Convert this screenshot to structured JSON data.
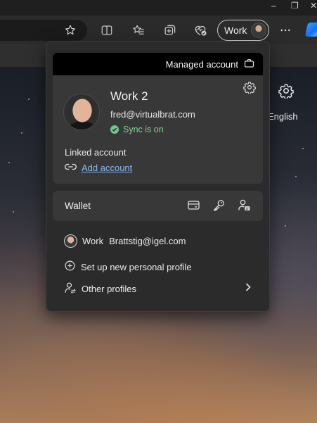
{
  "browser": {
    "profile_button_label": "Work",
    "window_controls": [
      "–",
      "❐",
      "✕"
    ]
  },
  "toolbar_icons": [
    "star-icon",
    "split-screen-icon",
    "favorites-icon",
    "collections-icon",
    "performance-icon",
    "more-icon",
    "copilot-icon"
  ],
  "ntp": {
    "language_label": "English"
  },
  "flyout": {
    "managed_label": "Managed account",
    "profile": {
      "name": "Work 2",
      "email": "fred@virtualbrat.com",
      "sync_status": "Sync is on"
    },
    "linked_account_label": "Linked account",
    "add_account_label": "Add account",
    "wallet_label": "Wallet",
    "other_profile": {
      "name": "Work",
      "email": "Brattstig@igel.com"
    },
    "new_profile_label": "Set up new personal profile",
    "other_profiles_label": "Other profiles"
  },
  "colors": {
    "sync_green": "#7fd69a",
    "link_blue": "#86b7f0",
    "card_bg": "#383838",
    "flyout_bg": "#2b2b2b"
  }
}
